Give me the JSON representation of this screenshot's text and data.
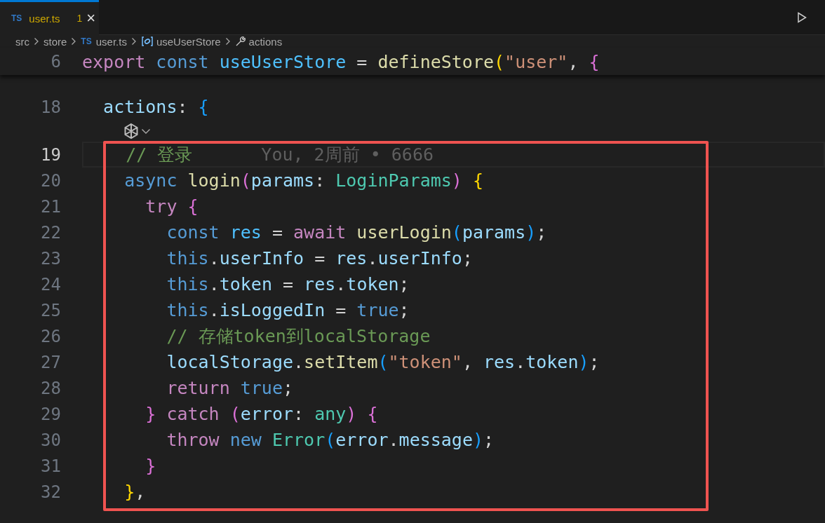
{
  "tab": {
    "icon": "TS",
    "name": "user.ts",
    "problems": "1",
    "close": "×",
    "selected": true
  },
  "breadcrumb": [
    {
      "kind": "folder",
      "text": "src"
    },
    {
      "kind": "folder",
      "text": "store"
    },
    {
      "kind": "ts",
      "icon": "TS",
      "text": "user.ts"
    },
    {
      "kind": "variable",
      "text": "useUserStore"
    },
    {
      "kind": "property",
      "text": "actions"
    }
  ],
  "sticky_line": {
    "number": "6",
    "tokens": [
      {
        "kind": "kw",
        "text": "export"
      },
      {
        "kind": "st",
        "text": " const"
      },
      {
        "kind": "cn",
        "text": " useUserStore"
      },
      {
        "kind": "p",
        "text": " ="
      },
      {
        "kind": "fn",
        "text": " defineStore"
      },
      {
        "kind": "b1",
        "text": "("
      },
      {
        "kind": "str",
        "text": "\"user\""
      },
      {
        "kind": "p",
        "text": ","
      },
      {
        "kind": "b2",
        "text": " {"
      }
    ]
  },
  "lines": [
    {
      "number": "18",
      "current": false,
      "codelens_after": true,
      "tokens": [
        {
          "kind": "var",
          "text": "  actions"
        },
        {
          "kind": "p",
          "text": ":"
        },
        {
          "kind": "b3",
          "text": " {"
        }
      ]
    }
  ],
  "highlight": {
    "lines": [
      {
        "number": "19",
        "current": true,
        "blame": "You, 2周前 • 6666",
        "tokens": [
          {
            "kind": "cmt",
            "text": "    // 登录"
          }
        ]
      },
      {
        "number": "20",
        "current": false,
        "tokens": [
          {
            "kind": "st",
            "text": "    async"
          },
          {
            "kind": "fn",
            "text": " login"
          },
          {
            "kind": "b2",
            "text": "("
          },
          {
            "kind": "var",
            "text": "params"
          },
          {
            "kind": "p",
            "text": ":"
          },
          {
            "kind": "type",
            "text": " LoginParams"
          },
          {
            "kind": "b2",
            "text": ")"
          },
          {
            "kind": "b1",
            "text": " {"
          }
        ]
      },
      {
        "number": "21",
        "current": false,
        "tokens": [
          {
            "kind": "kw",
            "text": "      try"
          },
          {
            "kind": "b2",
            "text": " {"
          }
        ]
      },
      {
        "number": "22",
        "current": false,
        "tokens": [
          {
            "kind": "st",
            "text": "        const"
          },
          {
            "kind": "cn",
            "text": " res"
          },
          {
            "kind": "p",
            "text": " ="
          },
          {
            "kind": "kw",
            "text": " await"
          },
          {
            "kind": "fn",
            "text": " userLogin"
          },
          {
            "kind": "b3",
            "text": "("
          },
          {
            "kind": "var",
            "text": "params"
          },
          {
            "kind": "b3",
            "text": ")"
          },
          {
            "kind": "p",
            "text": ";"
          }
        ]
      },
      {
        "number": "23",
        "current": false,
        "tokens": [
          {
            "kind": "st",
            "text": "        this"
          },
          {
            "kind": "p",
            "text": "."
          },
          {
            "kind": "var",
            "text": "userInfo"
          },
          {
            "kind": "p",
            "text": " ="
          },
          {
            "kind": "var",
            "text": " res"
          },
          {
            "kind": "p",
            "text": "."
          },
          {
            "kind": "var",
            "text": "userInfo"
          },
          {
            "kind": "p",
            "text": ";"
          }
        ]
      },
      {
        "number": "24",
        "current": false,
        "tokens": [
          {
            "kind": "st",
            "text": "        this"
          },
          {
            "kind": "p",
            "text": "."
          },
          {
            "kind": "var",
            "text": "token"
          },
          {
            "kind": "p",
            "text": " ="
          },
          {
            "kind": "var",
            "text": " res"
          },
          {
            "kind": "p",
            "text": "."
          },
          {
            "kind": "var",
            "text": "token"
          },
          {
            "kind": "p",
            "text": ";"
          }
        ]
      },
      {
        "number": "25",
        "current": false,
        "tokens": [
          {
            "kind": "st",
            "text": "        this"
          },
          {
            "kind": "p",
            "text": "."
          },
          {
            "kind": "var",
            "text": "isLoggedIn"
          },
          {
            "kind": "p",
            "text": " ="
          },
          {
            "kind": "st",
            "text": " true"
          },
          {
            "kind": "p",
            "text": ";"
          }
        ]
      },
      {
        "number": "26",
        "current": false,
        "tokens": [
          {
            "kind": "cmt",
            "text": "        // 存储token到localStorage"
          }
        ]
      },
      {
        "number": "27",
        "current": false,
        "tokens": [
          {
            "kind": "var",
            "text": "        localStorage"
          },
          {
            "kind": "p",
            "text": "."
          },
          {
            "kind": "fn",
            "text": "setItem"
          },
          {
            "kind": "b3",
            "text": "("
          },
          {
            "kind": "str",
            "text": "\"token\""
          },
          {
            "kind": "p",
            "text": ","
          },
          {
            "kind": "var",
            "text": " res"
          },
          {
            "kind": "p",
            "text": "."
          },
          {
            "kind": "var",
            "text": "token"
          },
          {
            "kind": "b3",
            "text": ")"
          },
          {
            "kind": "p",
            "text": ";"
          }
        ]
      },
      {
        "number": "28",
        "current": false,
        "tokens": [
          {
            "kind": "kw",
            "text": "        return"
          },
          {
            "kind": "st",
            "text": " true"
          },
          {
            "kind": "p",
            "text": ";"
          }
        ]
      },
      {
        "number": "29",
        "current": false,
        "tokens": [
          {
            "kind": "b2",
            "text": "      }"
          },
          {
            "kind": "kw",
            "text": " catch"
          },
          {
            "kind": "b2",
            "text": " ("
          },
          {
            "kind": "var",
            "text": "error"
          },
          {
            "kind": "p",
            "text": ":"
          },
          {
            "kind": "type",
            "text": " any"
          },
          {
            "kind": "b2",
            "text": ")"
          },
          {
            "kind": "b2",
            "text": " {"
          }
        ]
      },
      {
        "number": "30",
        "current": false,
        "tokens": [
          {
            "kind": "kw",
            "text": "        throw"
          },
          {
            "kind": "st",
            "text": " new"
          },
          {
            "kind": "type",
            "text": " Error"
          },
          {
            "kind": "b3",
            "text": "("
          },
          {
            "kind": "var",
            "text": "error"
          },
          {
            "kind": "p",
            "text": "."
          },
          {
            "kind": "var",
            "text": "message"
          },
          {
            "kind": "b3",
            "text": ")"
          },
          {
            "kind": "p",
            "text": ";"
          }
        ]
      },
      {
        "number": "31",
        "current": false,
        "tokens": [
          {
            "kind": "b2",
            "text": "      }"
          }
        ]
      },
      {
        "number": "32",
        "current": false,
        "tokens": [
          {
            "kind": "b1",
            "text": "    }"
          },
          {
            "kind": "p",
            "text": ","
          }
        ]
      }
    ]
  }
}
